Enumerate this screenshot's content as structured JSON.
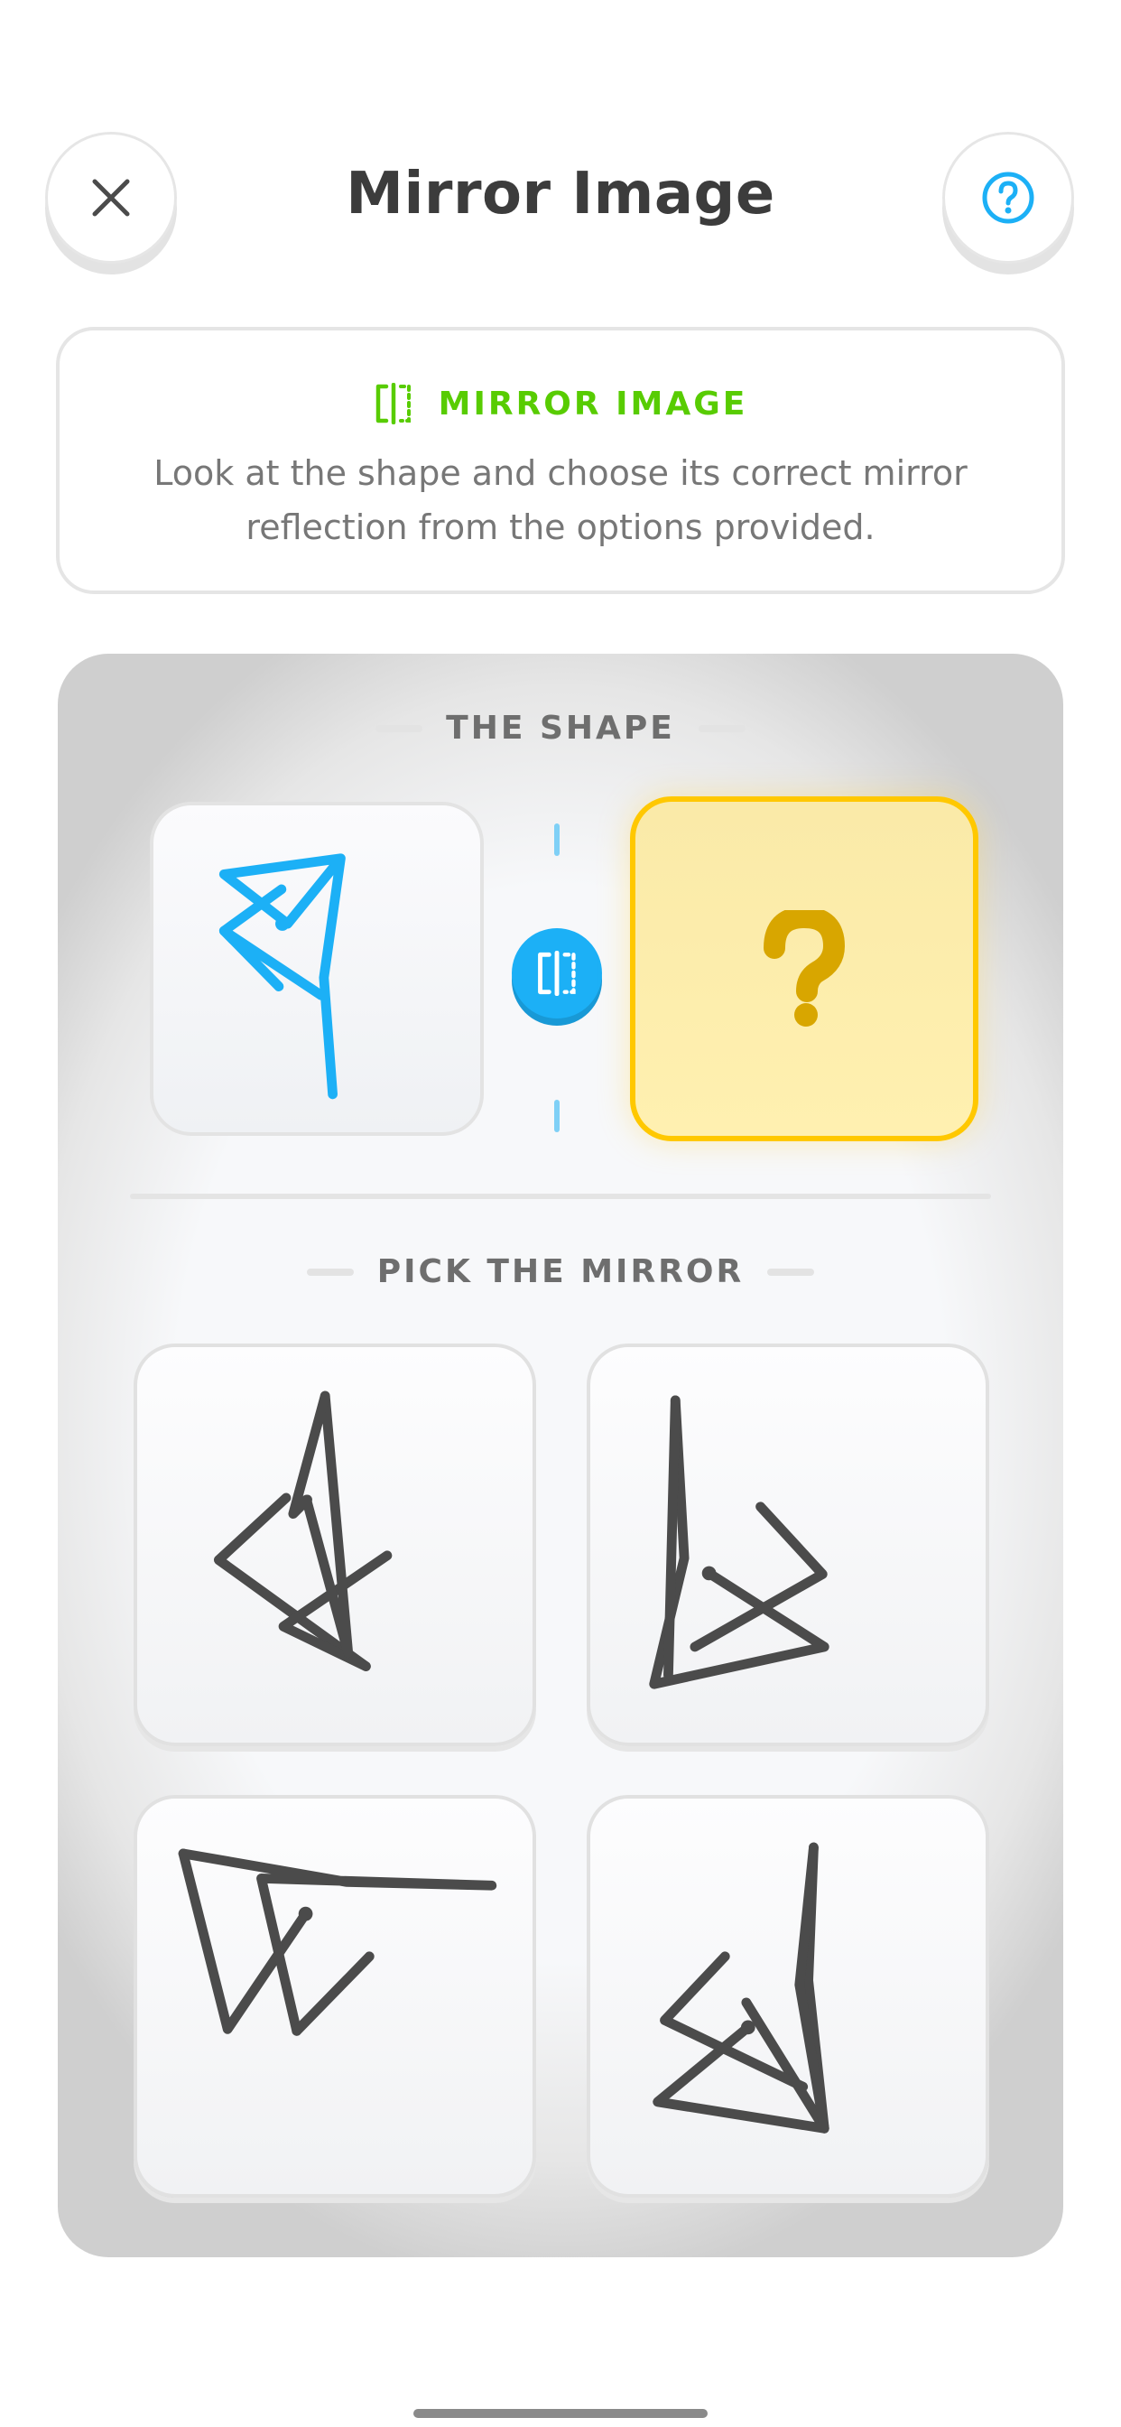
{
  "header": {
    "title": "Mirror Image",
    "close_icon": "close-icon",
    "help_icon": "help-icon"
  },
  "instruction": {
    "label": "MIRROR IMAGE",
    "text": "Look at the shape and choose its correct mirror reflection from the options provided.",
    "icon": "mirror-icon"
  },
  "puzzle": {
    "shape_label": "THE SHAPE",
    "answer_placeholder": "?",
    "mirror_icon": "mirror-icon",
    "pick_label": "PICK THE MIRROR",
    "options": [
      {
        "id": "option-1"
      },
      {
        "id": "option-2"
      },
      {
        "id": "option-3"
      },
      {
        "id": "option-4"
      }
    ]
  },
  "colors": {
    "accent_green": "#58cc02",
    "accent_blue": "#1cb0f6",
    "answer_yellow": "#ffc800",
    "shape_stroke": "#1cb0f6",
    "option_stroke": "#4b4b4b"
  }
}
